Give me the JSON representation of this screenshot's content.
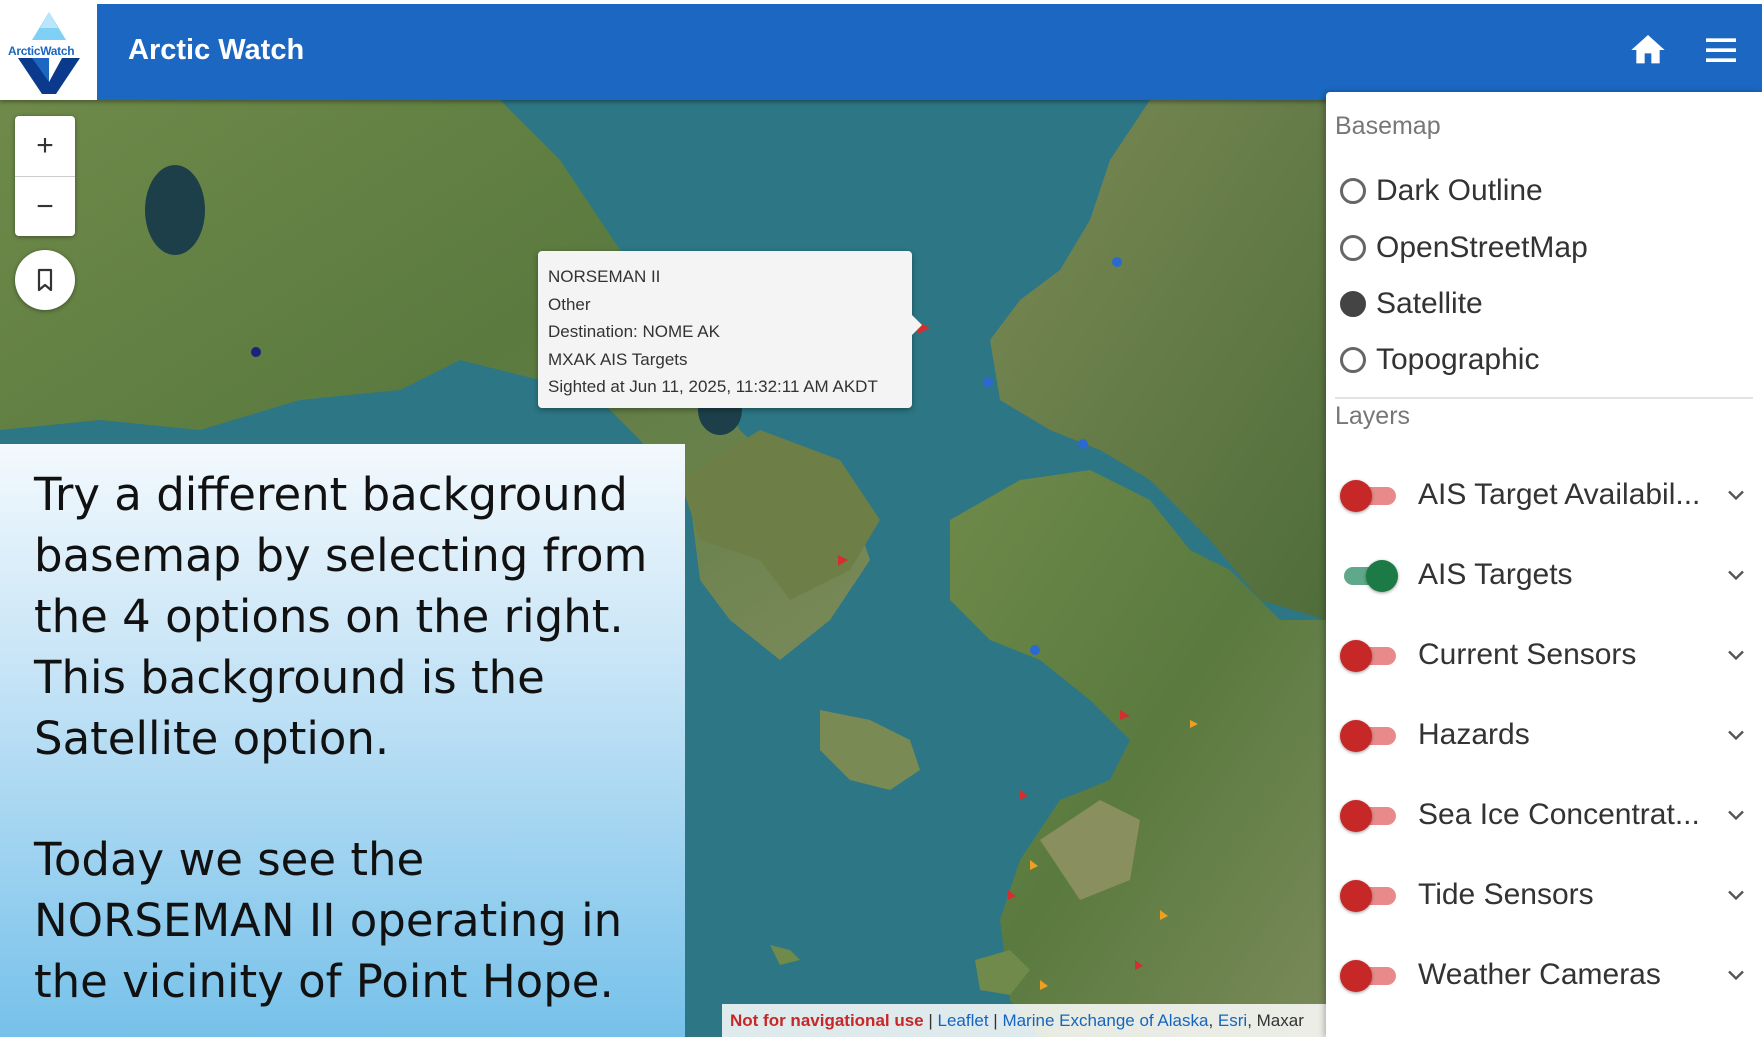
{
  "app": {
    "title": "Arctic Watch",
    "logo_text": "ArcticWatch",
    "home_icon": "home-icon",
    "menu_icon": "hamburger-menu-icon",
    "header_color": "#1b67c2"
  },
  "map": {
    "zoom_in": "+",
    "zoom_out": "−",
    "bookmark_icon": "bookmark-icon"
  },
  "popup": {
    "vessel_name": "NORSEMAN II",
    "vessel_type": "Other",
    "destination": "Destination: NOME AK",
    "source": "MXAK AIS Targets",
    "sighted": "Sighted at Jun 11, 2025, 11:32:11 AM AKDT"
  },
  "attribution": {
    "warning": "Not for navigational use",
    "sep": " | ",
    "leaflet": "Leaflet",
    "providers": "Marine Exchange of Alaska",
    "esri": "Esri",
    "maxar": "Maxar"
  },
  "note": {
    "paragraph1": "Try a different background basemap by selecting from the 4 options on the right. This background is the Satellite option.",
    "paragraph2": "Today we see the NORSEMAN II operating in the vicinity of Point Hope."
  },
  "panel": {
    "basemap_title": "Basemap",
    "basemaps": [
      {
        "label": "Dark Outline",
        "selected": false
      },
      {
        "label": "OpenStreetMap",
        "selected": false
      },
      {
        "label": "Satellite",
        "selected": true
      },
      {
        "label": "Topographic",
        "selected": false
      }
    ],
    "layers_title": "Layers",
    "layers": [
      {
        "label": "AIS Target Availabil...",
        "on": false
      },
      {
        "label": "AIS Targets",
        "on": true
      },
      {
        "label": "Current Sensors",
        "on": false
      },
      {
        "label": "Hazards",
        "on": false
      },
      {
        "label": "Sea Ice Concentrat...",
        "on": false
      },
      {
        "label": "Tide Sensors",
        "on": false
      },
      {
        "label": "Weather Cameras",
        "on": false
      }
    ],
    "toggle_on_color": "#1b7a45",
    "toggle_off_color": "#c62828"
  }
}
